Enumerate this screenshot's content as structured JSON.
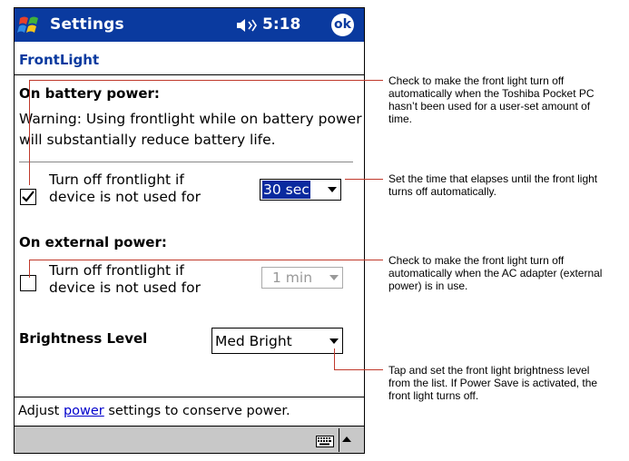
{
  "titlebar": {
    "app_title": "Settings",
    "time": "5:18",
    "ok_label": "ok",
    "start_icon": "windows-flag-icon",
    "volume_icon": "speaker-icon"
  },
  "page": {
    "title": "FrontLight"
  },
  "battery": {
    "heading": "On battery power:",
    "warning": "Warning: Using frontlight while on battery power will substantially reduce battery life.",
    "checkbox_label_line1": "Turn off frontlight if",
    "checkbox_label_line2": "device is not used for",
    "checked": true,
    "timeout_value": "30 sec"
  },
  "external": {
    "heading": "On external power:",
    "checkbox_label_line1": "Turn off frontlight if",
    "checkbox_label_line2": "device is not used for",
    "checked": false,
    "timeout_value": "1 min"
  },
  "brightness": {
    "label": "Brightness Level",
    "value": "Med Bright"
  },
  "footer": {
    "prefix": "Adjust ",
    "link": "power",
    "suffix": " settings to conserve power."
  },
  "menubar": {
    "keyboard_icon": "keyboard-icon"
  },
  "annotations": {
    "a1": "Check to make the front light turn off automatically when the Toshiba Pocket PC hasn’t been used for a user-set amount of time.",
    "a2": "Set the time that elapses until the front light turns off automatically.",
    "a3": "Check to make the front light turn off automatically when the AC adapter (external power) is in use.",
    "a4": "Tap and set the front light brightness level from the list. If Power Save is activated, the front light turns off."
  },
  "colors": {
    "titlebar": "#0a3a9f",
    "callout_line": "#c0392b",
    "link": "#0000cc"
  }
}
